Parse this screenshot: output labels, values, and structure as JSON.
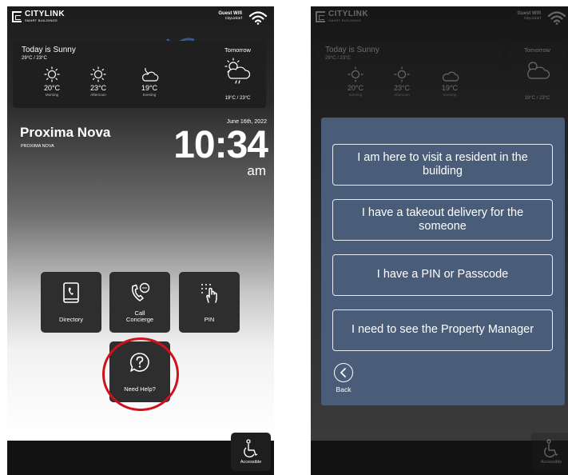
{
  "brand": {
    "name": "CITYLINK",
    "subtitle": "SMART BUILDINGS"
  },
  "wifi": {
    "title": "Guest Wifi",
    "network": "CityLink3rf"
  },
  "weather": {
    "today": {
      "title": "Today is Sunny",
      "range": "29°C / 23°C",
      "periods": [
        {
          "icon": "sun-icon",
          "temp": "20°C",
          "label": "Morning"
        },
        {
          "icon": "sun-icon",
          "temp": "23°C",
          "label": "Afternoon"
        },
        {
          "icon": "cloud-moon-icon",
          "temp": "19°C",
          "label": "Evening"
        }
      ]
    },
    "tomorrow": {
      "title": "Tomorrow",
      "icon": "sun-cloud-rain-icon",
      "range": "19°C / 23°C"
    }
  },
  "location": {
    "name": "Proxima Nova",
    "subtitle": "PROXIMA NOVA"
  },
  "clock": {
    "date": "June 16th, 2022",
    "time": "10:34",
    "ampm": "am"
  },
  "tiles": {
    "directory": {
      "label": "Directory",
      "icon": "address-book-icon"
    },
    "concierge": {
      "label": "Call\nConcierge",
      "icon": "phone-chat-icon"
    },
    "pin": {
      "label": "PIN",
      "icon": "keypad-touch-icon"
    },
    "help": {
      "label": "Need Help?",
      "icon": "question-bubble-icon"
    }
  },
  "accessible": {
    "label": "Accessible",
    "icon": "wheelchair-icon"
  },
  "help_menu": {
    "options": [
      "I am here to visit a resident in the building",
      "I have a takeout delivery for the someone",
      "I have a PIN or Passcode",
      "I need to see the Property Manager"
    ],
    "back_label": "Back"
  },
  "colors": {
    "highlight_ring": "#d0101b",
    "modal_bg": "#4a5d78",
    "tile_bg": "#2e2e2e"
  }
}
